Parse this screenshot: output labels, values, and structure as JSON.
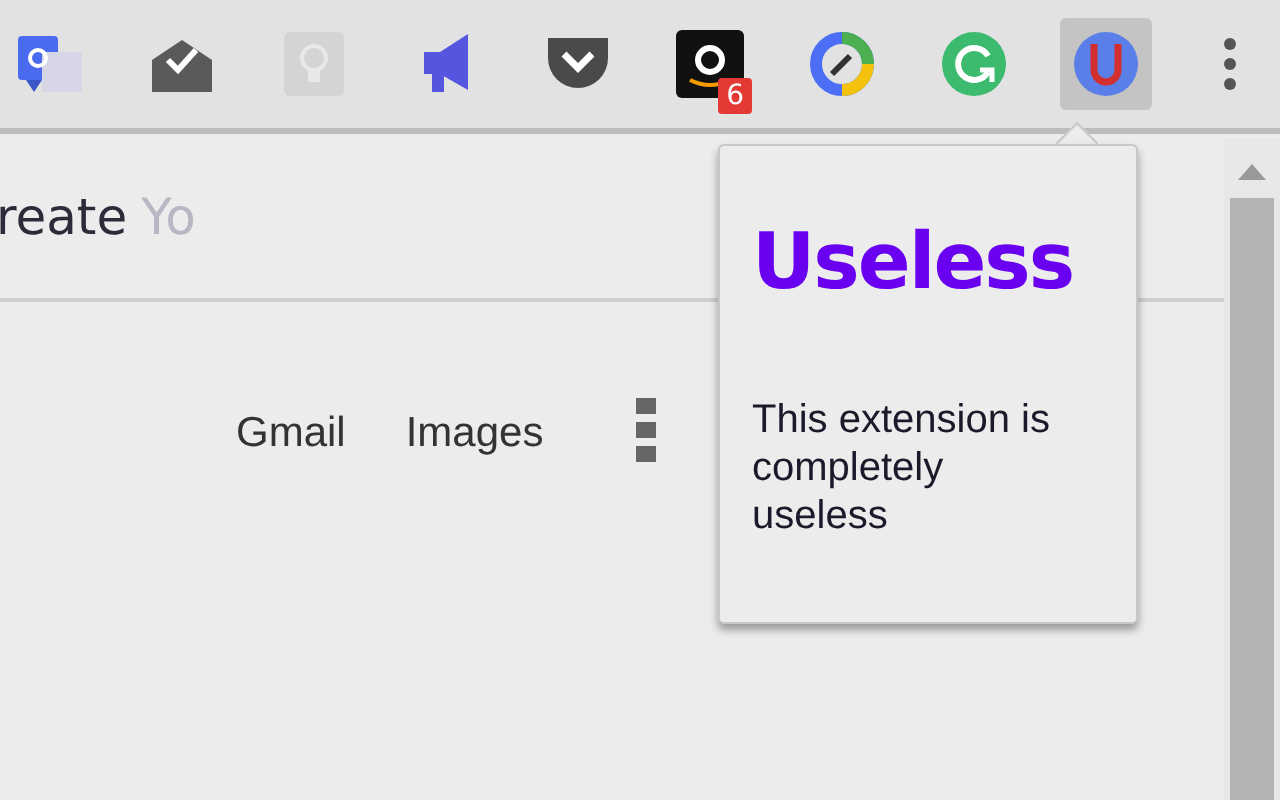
{
  "toolbar": {
    "extensions": [
      {
        "kind": "translate",
        "selected": false
      },
      {
        "kind": "inbox",
        "selected": false
      },
      {
        "kind": "bulb",
        "selected": false
      },
      {
        "kind": "megaphone",
        "selected": false
      },
      {
        "kind": "pocket",
        "selected": false
      },
      {
        "kind": "amazon",
        "selected": false,
        "badge": "6"
      },
      {
        "kind": "pencil",
        "selected": false
      },
      {
        "kind": "refresh",
        "selected": false
      },
      {
        "kind": "useless",
        "selected": true
      }
    ]
  },
  "document": {
    "title_text": "reate",
    "title_faded": "Yo"
  },
  "page": {
    "links": [
      "Gmail",
      "Images"
    ]
  },
  "popup": {
    "heading": "Useless",
    "body": "This extension is completely useless"
  }
}
